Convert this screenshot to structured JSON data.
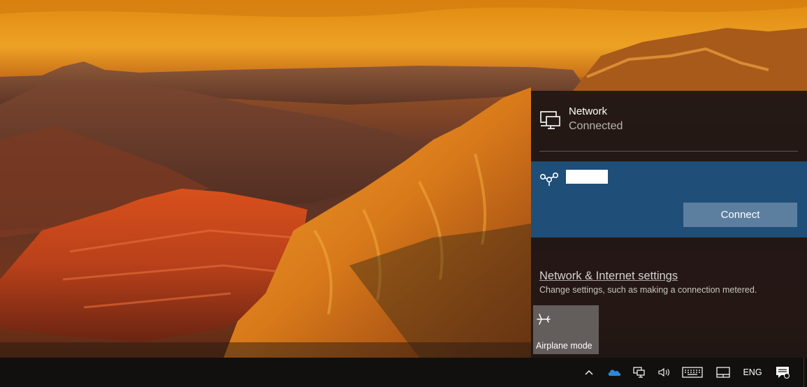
{
  "flyout": {
    "current_network": {
      "name": "Network",
      "status": "Connected",
      "icon": "wired-network-icon"
    },
    "wifi_network": {
      "ssid": "",
      "icon": "wifi-hotspot-icon",
      "connect_label": "Connect"
    },
    "settings": {
      "link_label": "Network & Internet settings",
      "description": "Change settings, such as making a connection metered."
    },
    "quick_actions": [
      {
        "label": "Airplane mode",
        "icon": "airplane-icon"
      }
    ]
  },
  "taskbar": {
    "tray": {
      "show_hidden_icon": "chevron-up-icon",
      "onedrive_icon": "cloud-icon",
      "network_icon": "network-icon",
      "volume_icon": "speaker-icon",
      "keyboard_icon": "keyboard-icon",
      "tablet_icon": "tablet-mode-icon",
      "language": "ENG",
      "notifications_icon": "action-center-icon"
    }
  },
  "colors": {
    "flyout_bg": "#1e1614",
    "selected_network_bg": "#1f4e78",
    "connect_button": "#5c7fa0",
    "onedrive_blue": "#2b88d8",
    "taskbar_bg": "#12100f"
  }
}
